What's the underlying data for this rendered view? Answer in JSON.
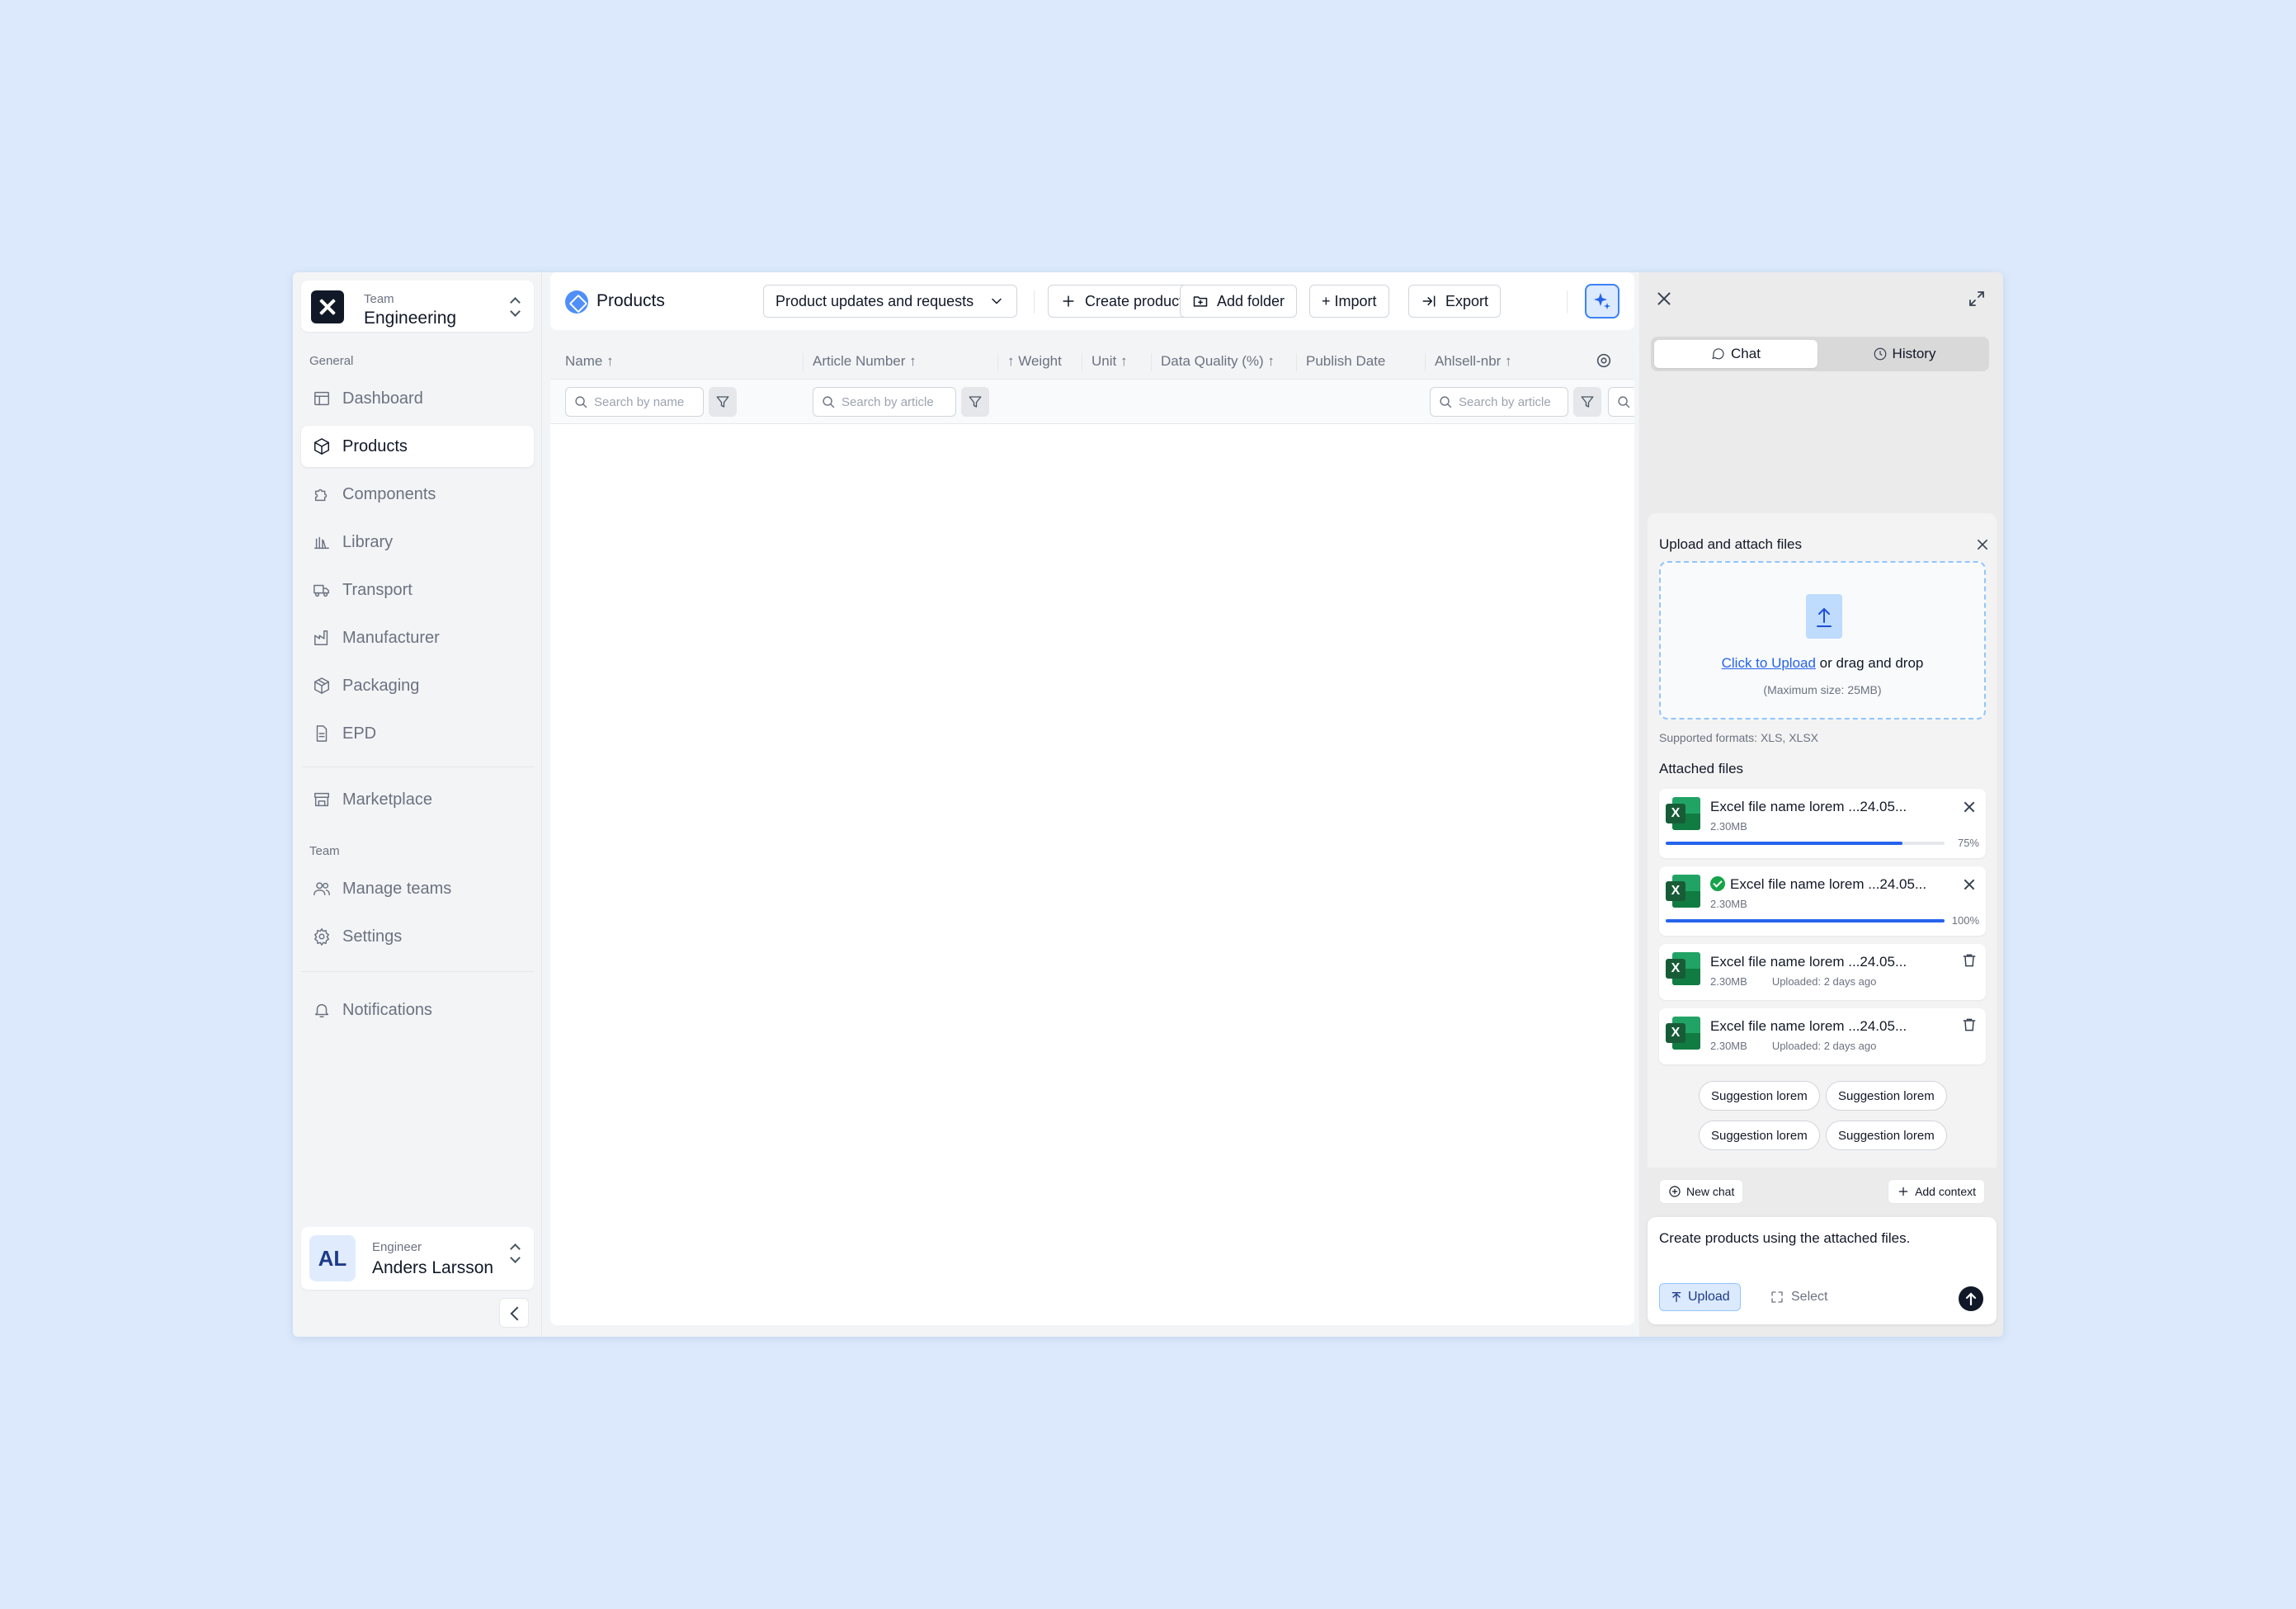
{
  "sidebar": {
    "team_label": "Team",
    "team_name": "Engineering",
    "general_label": "General",
    "items": [
      {
        "label": "Dashboard",
        "icon": "layout-icon"
      },
      {
        "label": "Products",
        "icon": "box-icon",
        "active": true
      },
      {
        "label": "Components",
        "icon": "puzzle-icon"
      },
      {
        "label": "Library",
        "icon": "library-icon"
      },
      {
        "label": "Transport",
        "icon": "truck-icon"
      },
      {
        "label": "Manufacturer",
        "icon": "factory-icon"
      },
      {
        "label": "Packaging",
        "icon": "package-icon"
      },
      {
        "label": "EPD",
        "icon": "document-icon"
      },
      {
        "label": "Marketplace",
        "icon": "store-icon"
      }
    ],
    "team_section_label": "Team",
    "team_items": [
      {
        "label": "Manage teams",
        "icon": "users-icon"
      },
      {
        "label": "Settings",
        "icon": "gear-icon"
      }
    ],
    "notifications_label": "Notifications",
    "user": {
      "initials": "AL",
      "role": "Engineer",
      "name": "Anders Larsson"
    }
  },
  "topbar": {
    "title": "Products",
    "view_select": "Product updates and requests",
    "create_label": "Create product",
    "add_folder_label": "Add folder",
    "import_label": "+ Import",
    "export_label": "Export"
  },
  "table": {
    "columns": [
      "Name",
      "Article Number",
      "Weight",
      "Unit",
      "Data Quality (%)",
      "Publish Date",
      "Ahlsell-nbr"
    ],
    "filters": {
      "name_placeholder": "Search by name",
      "article_placeholder": "Search by article",
      "ahlsell_placeholder": "Search by article"
    },
    "rows": []
  },
  "chat": {
    "tabs": {
      "chat": "Chat",
      "history": "History"
    },
    "upload_title": "Upload and attach files",
    "click_upload": "Click to Upload",
    "drag_text": " or drag and drop",
    "max_size": "(Maximum size: 25MB)",
    "formats": "Supported formats: XLS, XLSX",
    "attached_title": "Attached files",
    "files": [
      {
        "name": "Excel file name lorem ...24.05...",
        "size": "2.30MB",
        "progress": 75,
        "progress_label": "75%"
      },
      {
        "name": "Excel file name lorem ...24.05...",
        "size": "2.30MB",
        "progress": 100,
        "progress_label": "100%",
        "done": true
      },
      {
        "name": "Excel file name lorem ...24.05...",
        "size": "2.30MB",
        "uploaded": "Uploaded: 2 days ago"
      },
      {
        "name": "Excel file name lorem ...24.05...",
        "size": "2.30MB",
        "uploaded": "Uploaded: 2 days ago"
      }
    ],
    "suggestions": [
      "Suggestion lorem",
      "Suggestion lorem",
      "Suggestion lorem",
      "Suggestion lorem"
    ],
    "new_chat": "New chat",
    "add_context": "Add context",
    "message": "Create products using the attached files.",
    "upload_label": "Upload",
    "select_label": "Select"
  },
  "colors": {
    "background": "#dce9fc",
    "accent": "#2563eb",
    "excel_green": "#107c41"
  }
}
